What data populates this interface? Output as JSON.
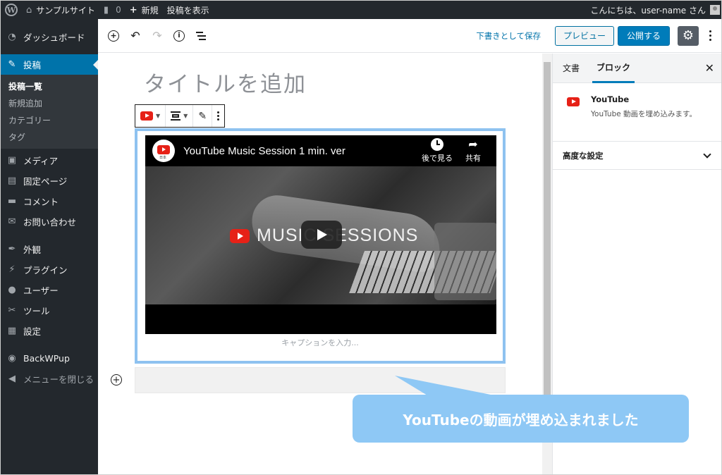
{
  "adminbar": {
    "site_name": "サンプルサイト",
    "comments_count": "0",
    "new_label": "新規",
    "view_post": "投稿を表示",
    "greeting": "こんにちは、user-name さん"
  },
  "sidebar": {
    "items": [
      {
        "label": "ダッシュボード",
        "icon": "dashboard-icon"
      },
      {
        "label": "投稿",
        "icon": "pin-icon"
      },
      {
        "label": "メディア",
        "icon": "media-icon"
      },
      {
        "label": "固定ページ",
        "icon": "page-icon"
      },
      {
        "label": "コメント",
        "icon": "comment-icon"
      },
      {
        "label": "お問い合わせ",
        "icon": "mail-icon"
      },
      {
        "label": "外観",
        "icon": "brush-icon"
      },
      {
        "label": "プラグイン",
        "icon": "plugin-icon"
      },
      {
        "label": "ユーザー",
        "icon": "user-icon"
      },
      {
        "label": "ツール",
        "icon": "wrench-icon"
      },
      {
        "label": "設定",
        "icon": "settings-icon"
      },
      {
        "label": "BackWPup",
        "icon": "backwpup-icon"
      },
      {
        "label": "メニューを閉じる",
        "icon": "collapse-icon"
      }
    ],
    "submenu": [
      "投稿一覧",
      "新規追加",
      "カテゴリー",
      "タグ"
    ]
  },
  "header": {
    "save_draft": "下書きとして保存",
    "preview": "プレビュー",
    "publish": "公開する"
  },
  "editor": {
    "title_placeholder": "タイトルを追加",
    "video": {
      "title": "YouTube Music Session 1 min. ver",
      "watch_later": "後で見る",
      "share": "共有",
      "brand_text": "MUSIC SESSIONS",
      "avatar_tag": "日本"
    },
    "caption_placeholder": "キャプションを入力..."
  },
  "settings": {
    "tab_document": "文書",
    "tab_block": "ブロック",
    "block_name": "YouTube",
    "block_description": "YouTube 動画を埋め込みます。",
    "advanced": "高度な設定"
  },
  "callout": {
    "text": "YouTubeの動画が埋め込まれました"
  },
  "colors": {
    "accent": "#0073aa",
    "youtube_red": "#e62117",
    "callout": "#8ec8f5",
    "admin_dark": "#23282d"
  }
}
